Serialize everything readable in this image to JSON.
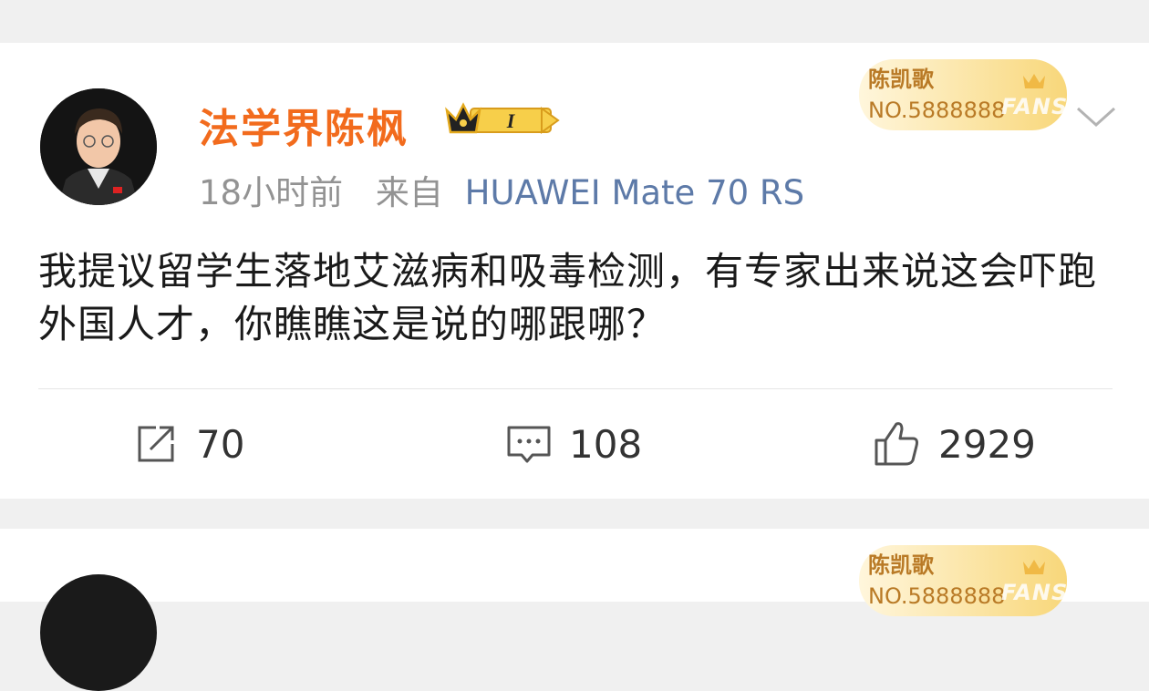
{
  "post": {
    "username": "法学界陈枫",
    "vip_level": "I",
    "time": "18小时前",
    "source_label": "来自",
    "device": "HUAWEI Mate 70 RS",
    "fan_badge": {
      "name": "陈凯歌",
      "number": "NO.5888888",
      "tag": "FANS"
    },
    "text": "我提议留学生落地艾滋病和吸毒检测，有专家出来说这会吓跑外国人才，你瞧瞧这是说的哪跟哪？",
    "actions": {
      "repost": "70",
      "comment": "108",
      "like": "2929"
    },
    "icons": [
      "share-icon",
      "comment-icon",
      "thumbs-up-icon",
      "chevron-down-icon",
      "crown-icon"
    ]
  },
  "next_post": {
    "fan_badge": {
      "name": "陈凯歌",
      "number": "NO.5888888",
      "tag": "FANS"
    }
  },
  "colors": {
    "username": "#f26b1d",
    "device": "#5d7aa8",
    "meta": "#939393",
    "badge_gold": "#b97a26"
  }
}
